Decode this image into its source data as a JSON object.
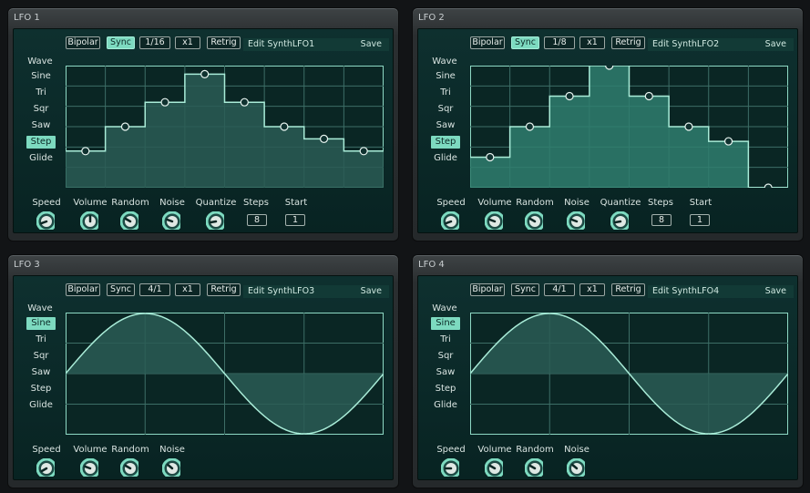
{
  "colors": {
    "accent": "#7ddac0",
    "panel_bg": "#0b2726",
    "graph_line": "#8de0c8"
  },
  "wave_types": [
    "Sine",
    "Tri",
    "Sqr",
    "Saw",
    "Step",
    "Glide"
  ],
  "wave_heading": "Wave",
  "panels": [
    {
      "title": "LFO 1",
      "bipolar": "Bipolar",
      "sync": "Sync",
      "sync_active": true,
      "rate": "1/16",
      "multiplier": "x1",
      "retrig": "Retrig",
      "edit_label": "Edit SynthLFO1",
      "save": "Save",
      "selected_wave": "Step",
      "step_values": [
        0.3,
        0.5,
        0.7,
        0.93,
        0.7,
        0.5,
        0.4,
        0.3
      ],
      "knobs": [
        "Speed",
        "Volume",
        "Random",
        "Noise",
        "Quantize"
      ],
      "steps_label": "Steps",
      "steps_value": "8",
      "start_label": "Start",
      "start_value": "1"
    },
    {
      "title": "LFO 2",
      "bipolar": "Bipolar",
      "sync": "Sync",
      "sync_active": true,
      "rate": "1/8",
      "multiplier": "x1",
      "retrig": "Retrig",
      "edit_label": "Edit SynthLFO2",
      "save": "Save",
      "selected_wave": "Step",
      "step_values": [
        0.25,
        0.5,
        0.75,
        1.0,
        0.75,
        0.5,
        0.38,
        0.0
      ],
      "knobs": [
        "Speed",
        "Volume",
        "Random",
        "Noise",
        "Quantize"
      ],
      "steps_label": "Steps",
      "steps_value": "8",
      "start_label": "Start",
      "start_value": "1"
    },
    {
      "title": "LFO 3",
      "bipolar": "Bipolar",
      "sync": "Sync",
      "sync_active": false,
      "rate": "4/1",
      "multiplier": "x1",
      "retrig": "Retrig",
      "edit_label": "Edit SynthLFO3",
      "save": "Save",
      "selected_wave": "Sine",
      "knobs": [
        "Speed",
        "Volume",
        "Random",
        "Noise"
      ]
    },
    {
      "title": "LFO 4",
      "bipolar": "Bipolar",
      "sync": "Sync",
      "sync_active": false,
      "rate": "4/1",
      "multiplier": "x1",
      "retrig": "Retrig",
      "edit_label": "Edit SynthLFO4",
      "save": "Save",
      "selected_wave": "Sine",
      "knobs": [
        "Speed",
        "Volume",
        "Random",
        "Noise"
      ]
    }
  ]
}
